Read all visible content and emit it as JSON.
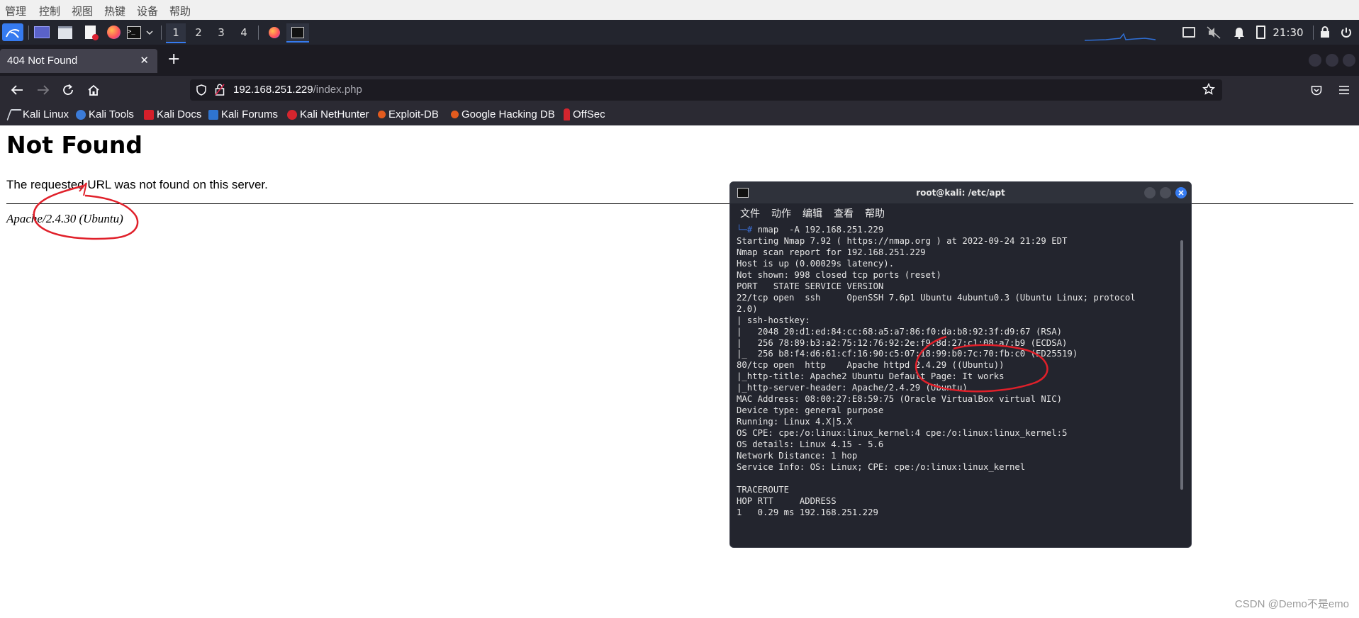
{
  "host_menu": [
    "管理",
    "控制",
    "视图",
    "热键",
    "设备",
    "帮助"
  ],
  "panel": {
    "workspaces": [
      "1",
      "2",
      "3",
      "4"
    ],
    "active_workspace": "1",
    "clock": "21:30",
    "icons": [
      "kali-menu-icon",
      "desktop-icon",
      "file-manager-icon",
      "text-editor-icon",
      "firefox-icon",
      "terminal-icon",
      "display-icon",
      "volume-muted-icon",
      "notification-bell-icon",
      "battery-icon",
      "lock-icon",
      "power-icon"
    ]
  },
  "browser": {
    "tab_title": "404 Not Found",
    "url_host": "192.168.251.229",
    "url_path": "/index.php",
    "bookmarks": [
      "Kali Linux",
      "Kali Tools",
      "Kali Docs",
      "Kali Forums",
      "Kali NetHunter",
      "Exploit-DB",
      "Google Hacking DB",
      "OffSec"
    ]
  },
  "page": {
    "heading": "Not Found",
    "message": "The requested URL was not found on this server.",
    "server_signature": "Apache/2.4.30 (Ubuntu)"
  },
  "terminal": {
    "title": "root@kali: /etc/apt",
    "menu": [
      "文件",
      "动作",
      "编辑",
      "查看",
      "帮助"
    ],
    "prompt_prefix": "└─# ",
    "command": "nmap  -A 192.168.251.229",
    "output": [
      "Starting Nmap 7.92 ( https://nmap.org ) at 2022-09-24 21:29 EDT",
      "Nmap scan report for 192.168.251.229",
      "Host is up (0.00029s latency).",
      "Not shown: 998 closed tcp ports (reset)",
      "PORT   STATE SERVICE VERSION",
      "22/tcp open  ssh     OpenSSH 7.6p1 Ubuntu 4ubuntu0.3 (Ubuntu Linux; protocol",
      "2.0)",
      "| ssh-hostkey:",
      "|   2048 20:d1:ed:84:cc:68:a5:a7:86:f0:da:b8:92:3f:d9:67 (RSA)",
      "|   256 78:89:b3:a2:75:12:76:92:2e:f9:8d:27:c1:08:a7:b9 (ECDSA)",
      "|_  256 b8:f4:d6:61:cf:16:90:c5:07:18:99:b0:7c:70:fb:c0 (ED25519)",
      "80/tcp open  http    Apache httpd 2.4.29 ((Ubuntu))",
      "|_http-title: Apache2 Ubuntu Default Page: It works",
      "|_http-server-header: Apache/2.4.29 (Ubuntu)",
      "MAC Address: 08:00:27:E8:59:75 (Oracle VirtualBox virtual NIC)",
      "Device type: general purpose",
      "Running: Linux 4.X|5.X",
      "OS CPE: cpe:/o:linux:linux_kernel:4 cpe:/o:linux:linux_kernel:5",
      "OS details: Linux 4.15 - 5.6",
      "Network Distance: 1 hop",
      "Service Info: OS: Linux; CPE: cpe:/o:linux:linux_kernel",
      "",
      "TRACEROUTE",
      "HOP RTT     ADDRESS",
      "1   0.29 ms 192.168.251.229"
    ]
  },
  "watermark": "CSDN @Demo不是emo",
  "colors": {
    "panel_bg": "#23252e",
    "browser_chrome": "#2b2a33",
    "tab_strip": "#1c1b22",
    "accent_blue": "#367bf0",
    "annotation_red": "#e0202a"
  }
}
